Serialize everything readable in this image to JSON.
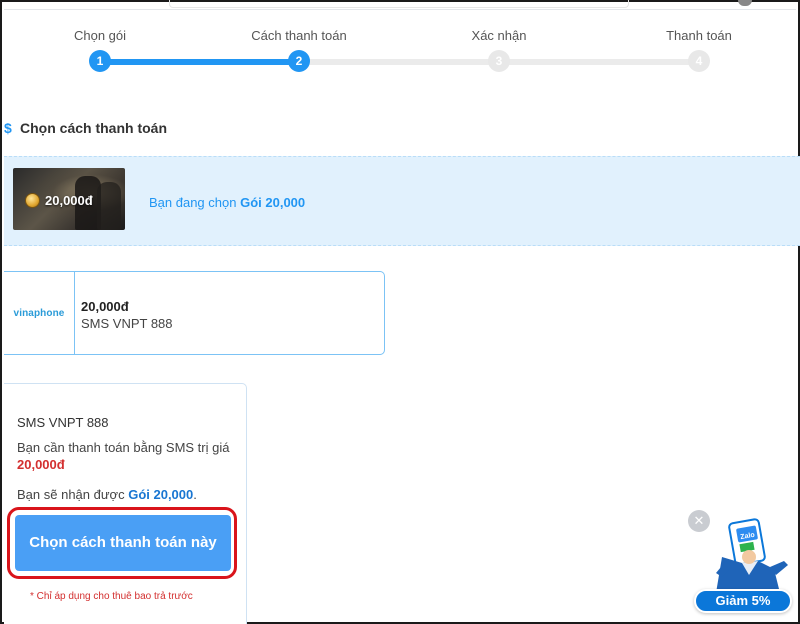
{
  "stepper": {
    "steps": [
      {
        "label": "Chọn gói",
        "number": "1",
        "state": "done"
      },
      {
        "label": "Cách thanh toán",
        "number": "2",
        "state": "active"
      },
      {
        "label": "Xác nhận",
        "number": "3",
        "state": "pending"
      },
      {
        "label": "Thanh toán",
        "number": "4",
        "state": "pending"
      }
    ],
    "accent": "#2196f3"
  },
  "section": {
    "title": "Chọn cách thanh toán",
    "icon": "dollar-icon"
  },
  "selected_package": {
    "thumb_value": "20,000đ",
    "prefix": "Bạn đang chọn",
    "package_name": "Gói 20,000"
  },
  "payment_method": {
    "logo_text": "vinaphone",
    "price": "20,000đ",
    "name": "SMS VNPT 888"
  },
  "detail": {
    "title": "SMS VNPT 888",
    "desc_prefix": "Bạn cần thanh toán bằng SMS trị giá",
    "desc_amount": "20,000đ",
    "receive_prefix": "Bạn sẽ nhận được",
    "receive_package": "Gói 20,000",
    "receive_suffix": ".",
    "cta_label": "Chọn cách thanh toán này",
    "note": "* Chỉ áp dụng cho thuê bao trả trước",
    "highlight_color": "#d9141b"
  },
  "promo": {
    "close_symbol": "✕",
    "logo_text": "Zalo",
    "badge_label": "Giảm 5%"
  }
}
